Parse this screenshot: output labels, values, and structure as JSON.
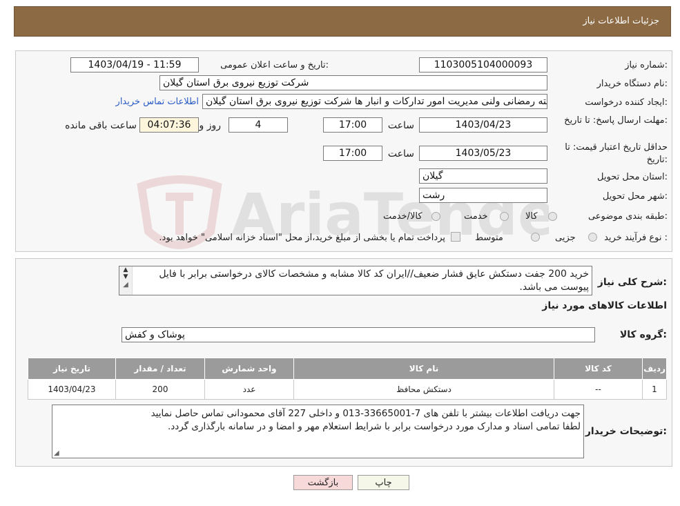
{
  "header": {
    "title": "جزئیات اطلاعات نیاز"
  },
  "watermark": {
    "text": "AriaTender.neT"
  },
  "fields": {
    "need_number_label": "شماره نیاز:",
    "need_number": "1103005104000093",
    "announce_label": "تاریخ و ساعت اعلان عمومی:",
    "announce_value": "1403/04/19 - 11:59",
    "buyer_org_label": "نام دستگاه خریدار:",
    "buyer_org": "شرکت توزیع نیروی برق استان گیلان",
    "creator_label": "ایجاد کننده درخواست:",
    "creator": "فرشته رمضانی ولنی مدیریت امور تدارکات و انبار ها شرکت توزیع نیروی برق استان گیلان",
    "contact_link": "اطلاعات تماس خریدار",
    "reply_deadline_label": "مهلت ارسال پاسخ: تا تاریخ:",
    "reply_date": "1403/04/23",
    "time_label": "ساعت",
    "reply_time": "17:00",
    "days": "4",
    "days_label": "روز و",
    "remaining": "04:07:36",
    "remaining_label": "ساعت باقی مانده",
    "price_validity_label": "حداقل تاریخ اعتبار قیمت: تا تاریخ:",
    "price_date": "1403/05/23",
    "price_time": "17:00",
    "province_label": "استان محل تحویل:",
    "province": "گیلان",
    "city_label": "شهر محل تحویل:",
    "city": "رشت",
    "category_label": "طبقه بندی موضوعی:",
    "category_options": [
      "کالا",
      "خدمت",
      "کالا/خدمت"
    ],
    "process_label": "نوع فرآیند خرید :",
    "process_options": [
      "جزیی",
      "متوسط"
    ],
    "process_note": "پرداخت تمام یا بخشی از مبلغ خرید،از محل \"اسناد خزانه اسلامی\" خواهد بود."
  },
  "description": {
    "label": "شرح کلی نیاز:",
    "text": "خرید 200 جفت دستکش عایق فشار ضعیف//ایران کد کالا مشابه و مشخصات کالای درخواستی برابر با فایل پیوست می باشد."
  },
  "goods": {
    "section_title": "اطلاعات کالاهای مورد نیاز",
    "group_label": "گروه کالا:",
    "group_value": "پوشاک و کفش",
    "columns": [
      "ردیف",
      "کد کالا",
      "نام کالا",
      "واحد شمارش",
      "تعداد / مقدار",
      "تاریخ نیاز"
    ],
    "rows": [
      [
        "1",
        "--",
        "دستکش محافظ",
        "عدد",
        "200",
        "1403/04/23"
      ]
    ]
  },
  "buyer_notes": {
    "label": "توضیحات خریدار:",
    "line1": "جهت دریافت اطلاعات بیشتر با تلفن های 7-33665001-013 و داخلی 227 آقای محمودانی تماس حاصل نمایید",
    "line2": "لطفا تمامی اسناد و مدارک مورد درخواست برابر با شرایط استعلام مهر و امضا و در سامانه بارگذاری گردد."
  },
  "buttons": {
    "print": "چاپ",
    "back": "بازگشت"
  },
  "colors": {
    "header_bg": "#8b6a44",
    "table_header_bg": "#9b9b9b",
    "link": "#2a5bc7",
    "back_button_bg": "#f7d9d9"
  }
}
